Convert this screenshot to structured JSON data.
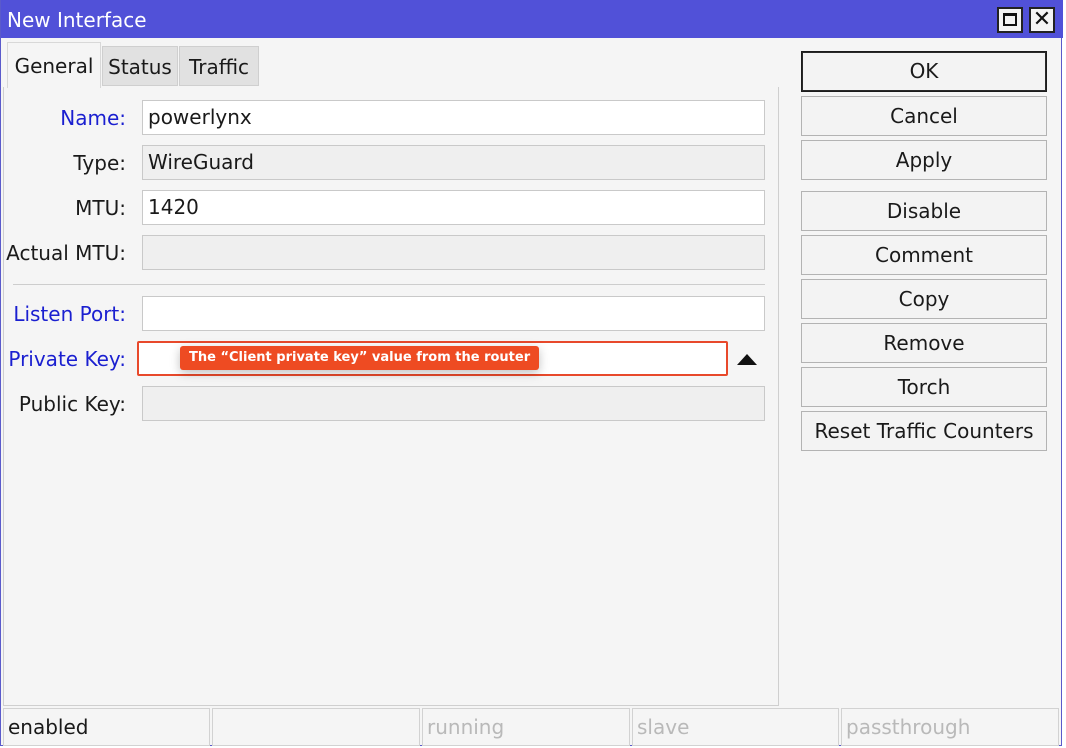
{
  "window": {
    "title": "New Interface"
  },
  "tabs": [
    {
      "label": "General",
      "active": true
    },
    {
      "label": "Status",
      "active": false
    },
    {
      "label": "Traffic",
      "active": false
    }
  ],
  "form": {
    "name": {
      "label": "Name:",
      "value": "powerlynx"
    },
    "type": {
      "label": "Type:",
      "value": "WireGuard"
    },
    "mtu": {
      "label": "MTU:",
      "value": "1420"
    },
    "actual_mtu": {
      "label": "Actual MTU:",
      "value": ""
    },
    "listen_port": {
      "label": "Listen Port:",
      "value": ""
    },
    "private_key": {
      "label": "Private Key:",
      "value": "",
      "annotation": "The “Client private key” value from the router"
    },
    "public_key": {
      "label": "Public Key:",
      "value": ""
    }
  },
  "buttons": {
    "ok": "OK",
    "cancel": "Cancel",
    "apply": "Apply",
    "disable": "Disable",
    "comment": "Comment",
    "copy": "Copy",
    "remove": "Remove",
    "torch": "Torch",
    "reset": "Reset Traffic Counters"
  },
  "statusbar": [
    "enabled",
    "",
    "running",
    "slave",
    "passthrough"
  ],
  "colors": {
    "titlebar": "#5151d8",
    "link_label": "#1a1fd0",
    "annotation": "#ee4b22"
  },
  "icons": {
    "maximize": "maximize-icon",
    "close": "close-icon",
    "collapse": "caret-up-icon"
  }
}
